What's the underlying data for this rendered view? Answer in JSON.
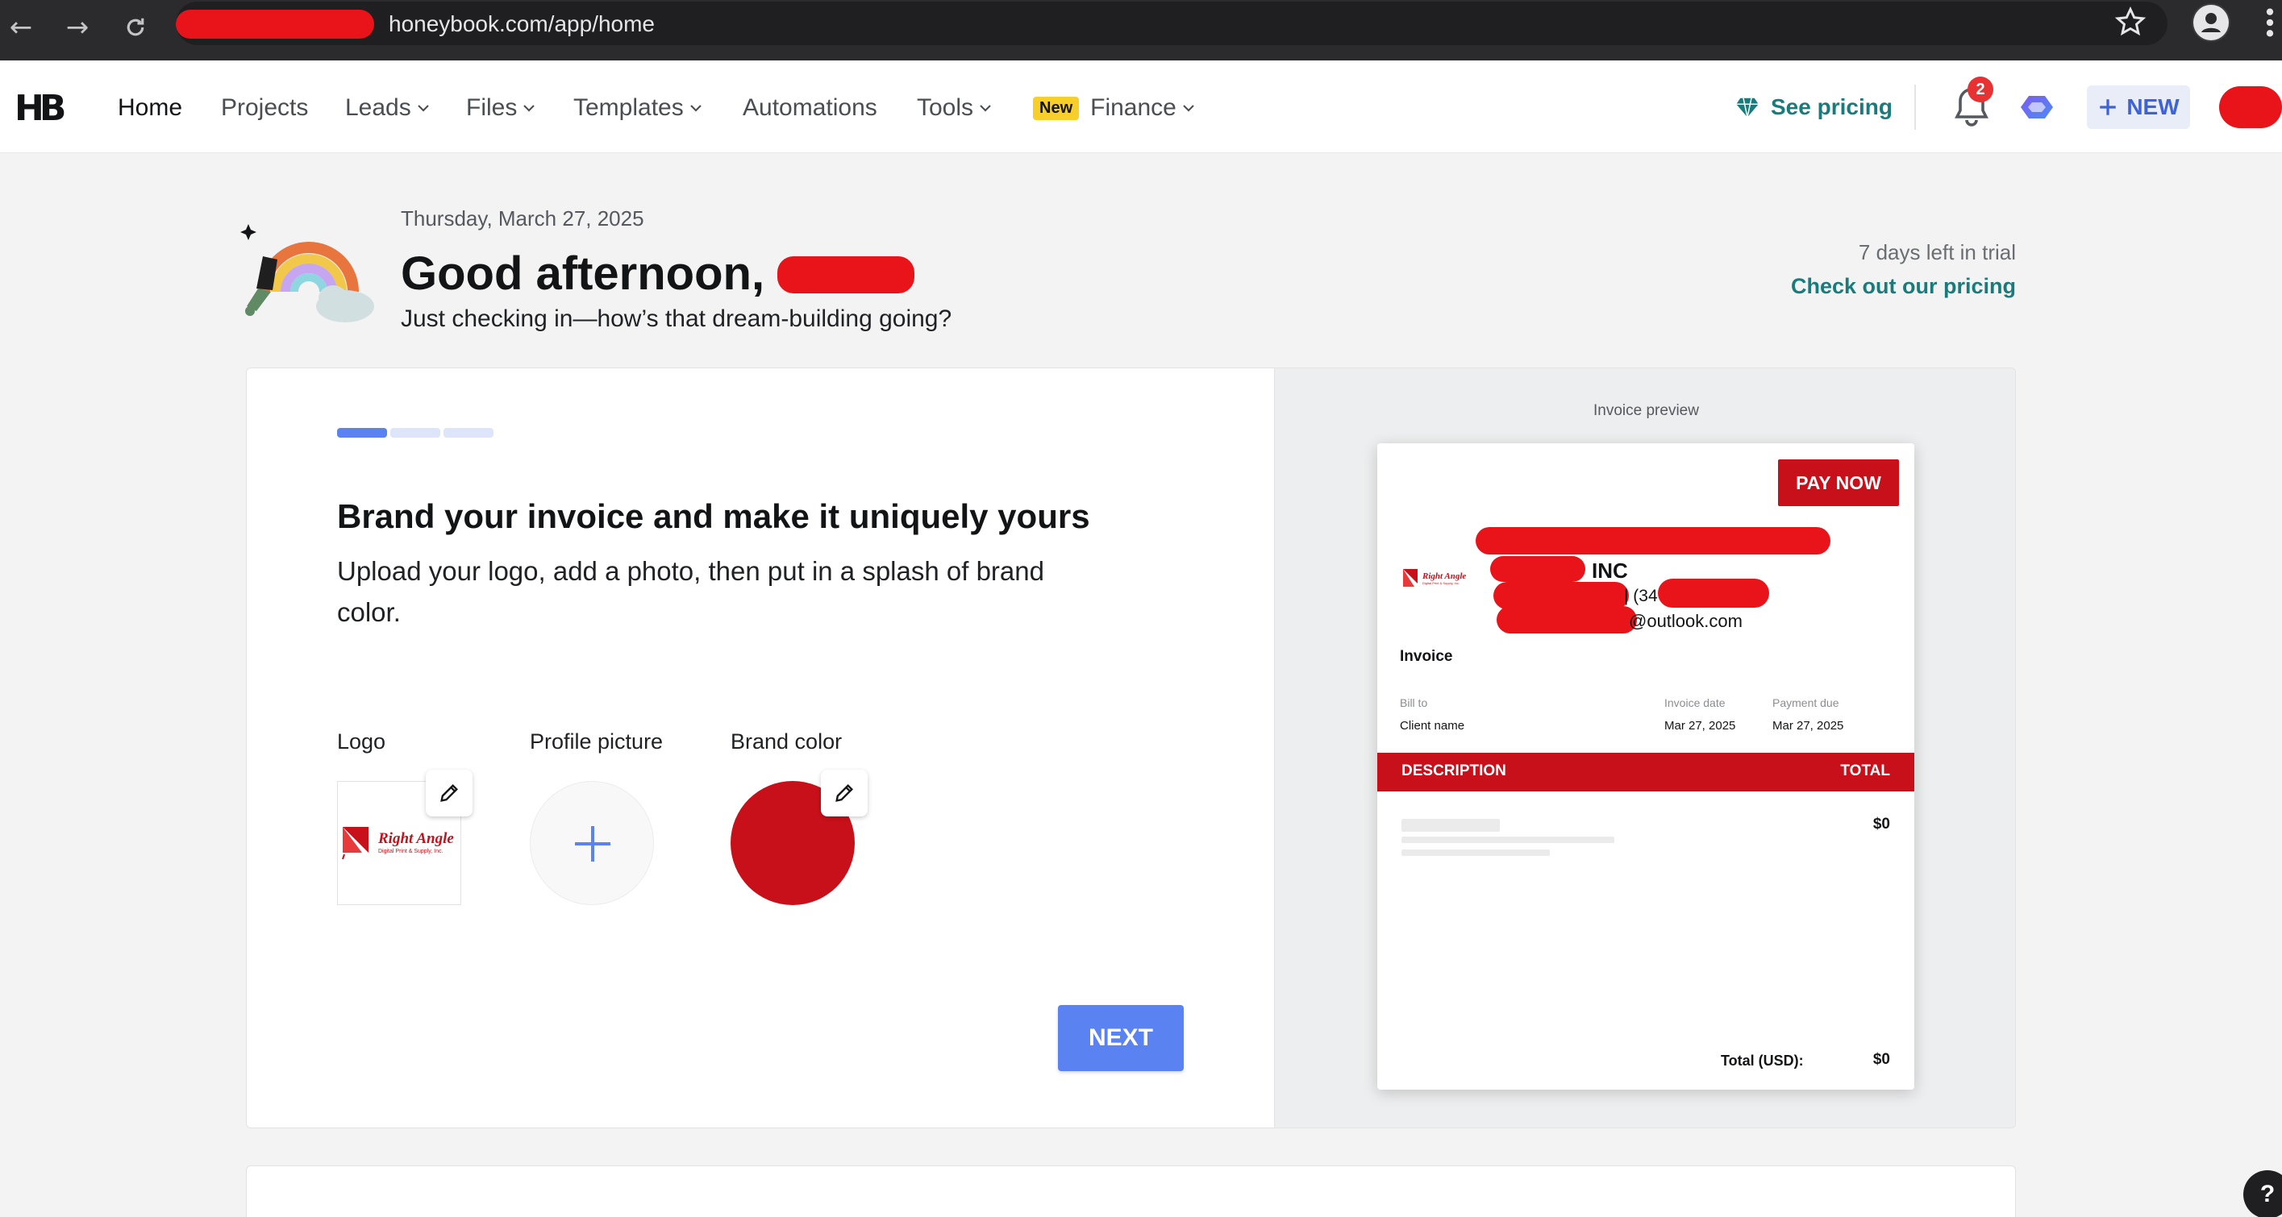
{
  "browser": {
    "url": "honeybook.com/app/home"
  },
  "header": {
    "logo_text": "HB",
    "nav": [
      {
        "label": "Home"
      },
      {
        "label": "Projects"
      },
      {
        "label": "Leads"
      },
      {
        "label": "Files"
      },
      {
        "label": "Templates"
      },
      {
        "label": "Automations"
      },
      {
        "label": "Tools"
      },
      {
        "label": "Finance",
        "badge": "New"
      }
    ],
    "see_pricing": "See pricing",
    "notification_count": "2",
    "new_button": "NEW"
  },
  "greeting": {
    "date": "Thursday, March 27, 2025",
    "title": "Good afternoon,",
    "subtitle": "Just checking in—how’s that dream-building going?",
    "trial_text": "7 days left in trial",
    "trial_link": "Check out our pricing"
  },
  "onboarding": {
    "progress_steps": 3,
    "progress_done": 1,
    "title": "Brand your invoice and make it uniquely yours",
    "description": "Upload your logo, add a photo, then put in a splash of brand color.",
    "logo_label": "Logo",
    "profile_label": "Profile picture",
    "brand_color_label": "Brand color",
    "brand_color": "#c8101a",
    "logo_brand_name": "Right Angle",
    "logo_brand_tagline": "Digital Print & Supply, Inc.",
    "next_button": "NEXT"
  },
  "invoice_preview": {
    "title": "Invoice preview",
    "pay_now": "PAY NOW",
    "company_suffix": "INC",
    "phone_fragment": "| (34",
    "email_fragment": "@outlook.com",
    "heading": "Invoice",
    "bill_to_label": "Bill to",
    "bill_to_value": "Client name",
    "invoice_date_label": "Invoice date",
    "invoice_date_value": "Mar 27, 2025",
    "payment_due_label": "Payment due",
    "payment_due_value": "Mar 27, 2025",
    "col_description": "DESCRIPTION",
    "col_total": "TOTAL",
    "line_amount": "$0",
    "total_label": "Total (USD):",
    "total_value": "$0"
  },
  "help_button": "?"
}
